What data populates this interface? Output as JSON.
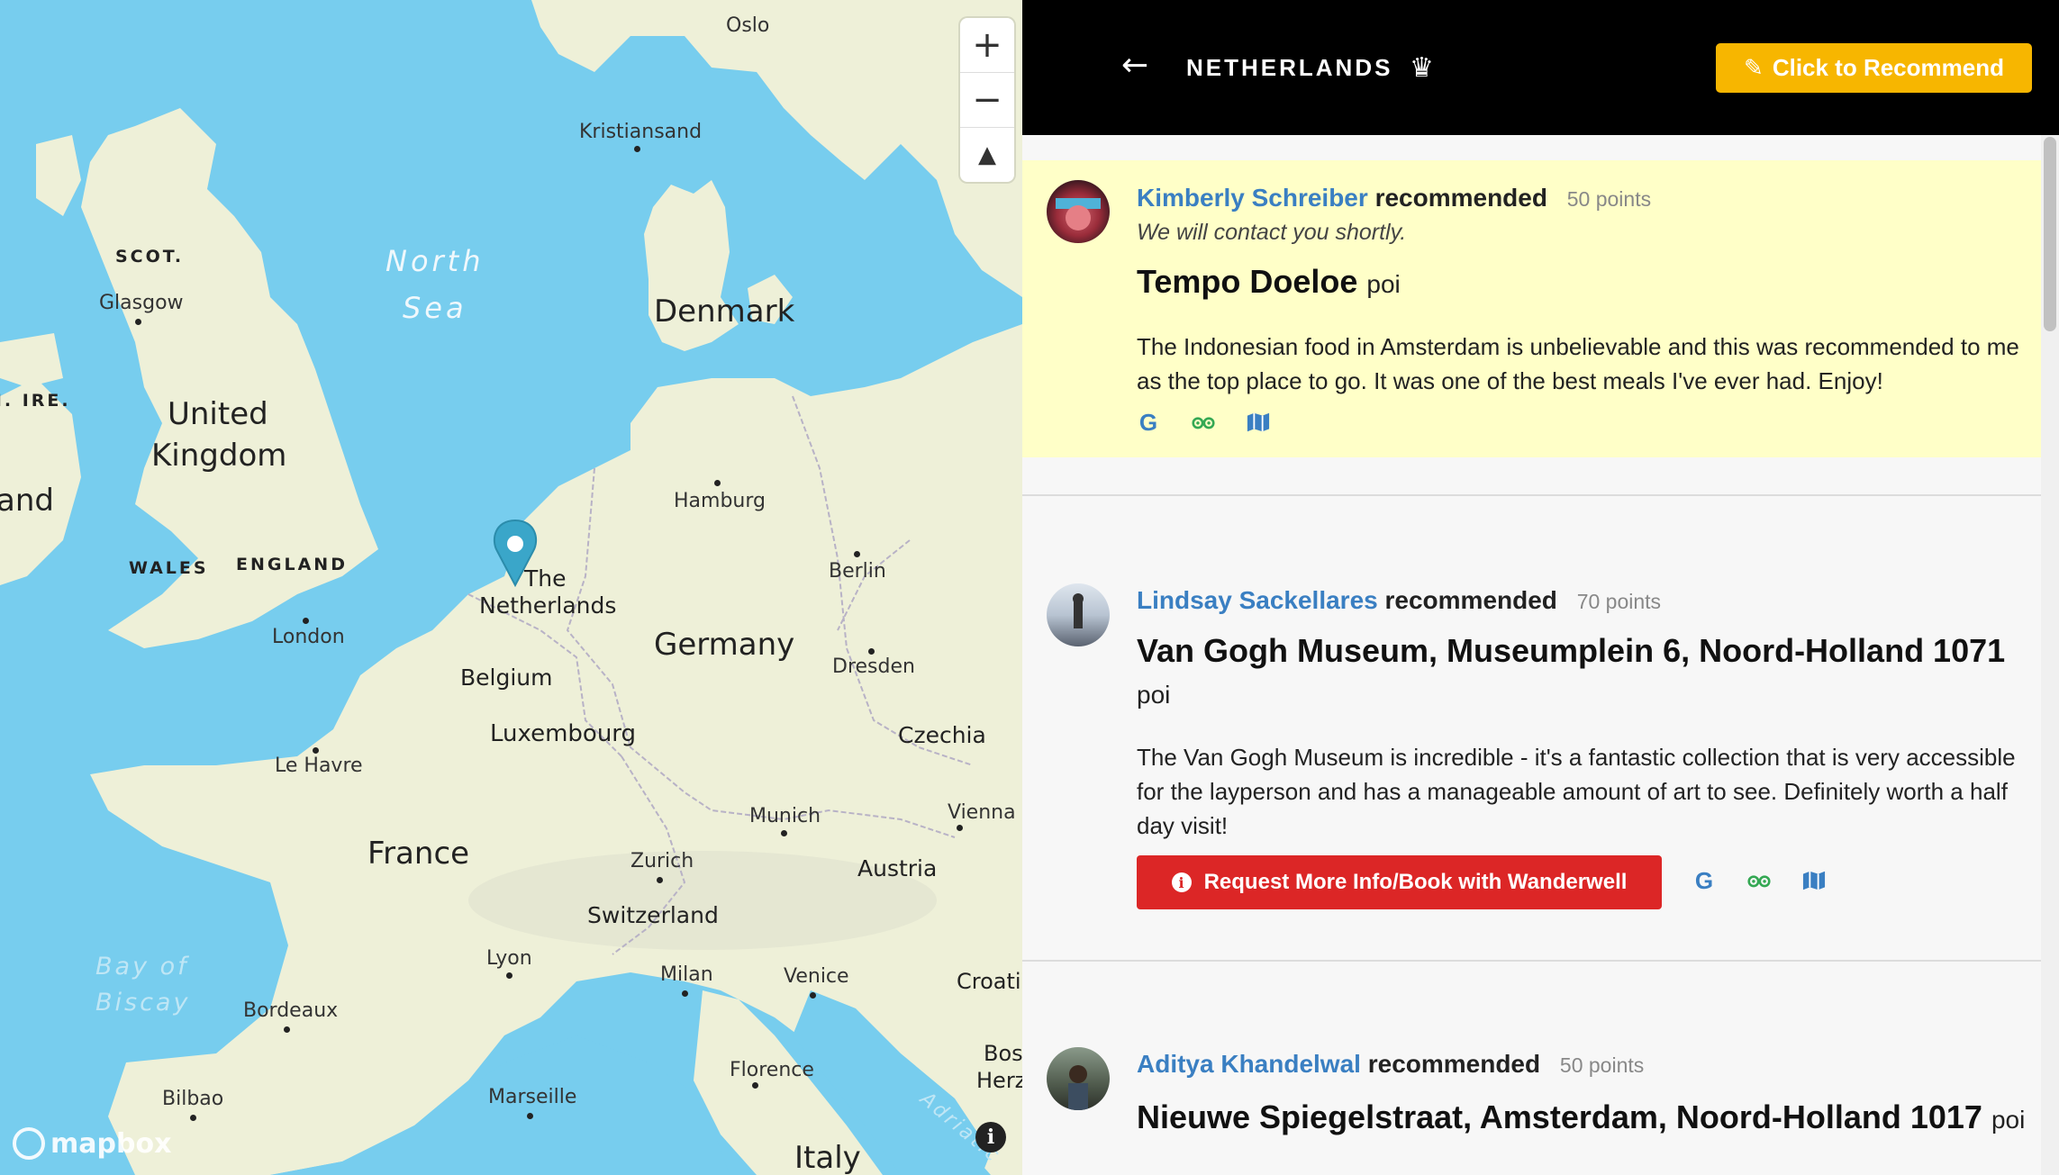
{
  "map": {
    "labels": {
      "oslo": "Oslo",
      "kristiansand": "Kristiansand",
      "scot": "SCOT.",
      "glasgow": "Glasgow",
      "north": "North",
      "sea": "Sea",
      "denmark": "Denmark",
      "ire": "N. IRE.",
      "united": "United",
      "kingdom": "Kingdom",
      "and": "and",
      "hamburg": "Hamburg",
      "wales": "WALES",
      "england": "ENGLAND",
      "the": "The",
      "netherlands": "Netherlands",
      "berlin": "Berlin",
      "london": "London",
      "germany": "Germany",
      "belgium": "Belgium",
      "dresden": "Dresden",
      "luxembourg": "Luxembourg",
      "czechia": "Czechia",
      "le_havre": "Le Havre",
      "munich": "Munich",
      "vienna": "Vienna",
      "france": "France",
      "zurich": "Zurich",
      "austria": "Austria",
      "switzerland": "Switzerland",
      "lyon": "Lyon",
      "milan": "Milan",
      "venice": "Venice",
      "croatia": "Croatia",
      "bay_of": "Bay of",
      "biscay": "Biscay",
      "bordeaux": "Bordeaux",
      "bos": "Bos",
      "herz": "Herz",
      "florence": "Florence",
      "bilbao": "Bilbao",
      "marseille": "Marseille",
      "adriatic": "Adriatic",
      "italy": "Italy"
    },
    "zoom_in": "+",
    "zoom_out": "−",
    "compass": "▲",
    "attribution_logo": "mapbox",
    "info": "i",
    "colors": {
      "water": "#77cdee",
      "land": "#eef0d8",
      "marker": "#3aa6c9"
    }
  },
  "header": {
    "back": "←",
    "title": "NETHERLANDS",
    "crown": "♛",
    "recommend_button": "Click to Recommend",
    "recommend_icon": "✎",
    "accent": "#f7b600"
  },
  "recommendations": [
    {
      "user": "Kimberly Schreiber",
      "verb": "recommended",
      "points": "50 points",
      "status": "We will contact you shortly.",
      "place": "Tempo Doeloe",
      "type": "poi",
      "description": "The Indonesian food in Amsterdam is unbelievable and this was recommended to me as the top place to go. It was one of the best meals I've ever had. Enjoy!",
      "highlighted": true
    },
    {
      "user": "Lindsay Sackellares",
      "verb": "recommended",
      "points": "70 points",
      "place": "Van Gogh Museum, Museumplein 6, Noord-Holland 1071",
      "type": "poi",
      "description": "The Van Gogh Museum is incredible - it's a fantastic collection that is very accessible for the layperson and has a manageable amount of art to see. Definitely worth a half day visit!",
      "action_button": "Request More Info/Book with Wanderwell"
    },
    {
      "user": "Aditya Khandelwal",
      "verb": "recommended",
      "points": "50 points",
      "place": "Nieuwe Spiegelstraat, Amsterdam, Noord-Holland 1017",
      "type": "poi"
    }
  ],
  "link_icons": {
    "google": "G",
    "tripadvisor": "tripadvisor-icon",
    "map": "map-icon"
  }
}
